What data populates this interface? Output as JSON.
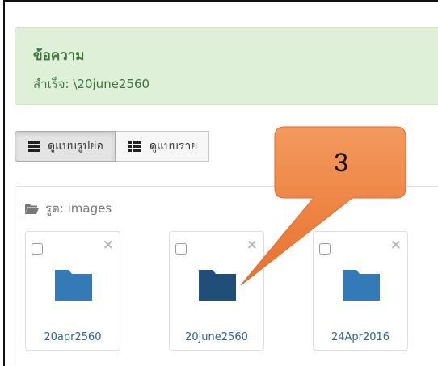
{
  "alert": {
    "title": "ข้อความ",
    "message": "สำเร็จ: \\20june2560",
    "color": "#3c763d",
    "background": "#dff0d8"
  },
  "view_buttons": [
    {
      "label": "ดูแบบรูปย่อ",
      "icon": "grid-icon",
      "active": true
    },
    {
      "label": "ดูแบบราย",
      "icon": "list-icon",
      "active": false
    }
  ],
  "panel": {
    "folder_label": "รูต: images",
    "icon": "folder-open-icon"
  },
  "items": [
    {
      "name": "20apr2560",
      "close": "×",
      "folder_color": "#337ab7"
    },
    {
      "name": "20june2560",
      "close": "×",
      "folder_color": "#1f4e79"
    },
    {
      "name": "24Apr2016",
      "close": "×",
      "folder_color": "#337ab7"
    }
  ],
  "callout": {
    "number": "3",
    "color": "#ee7a3a"
  }
}
